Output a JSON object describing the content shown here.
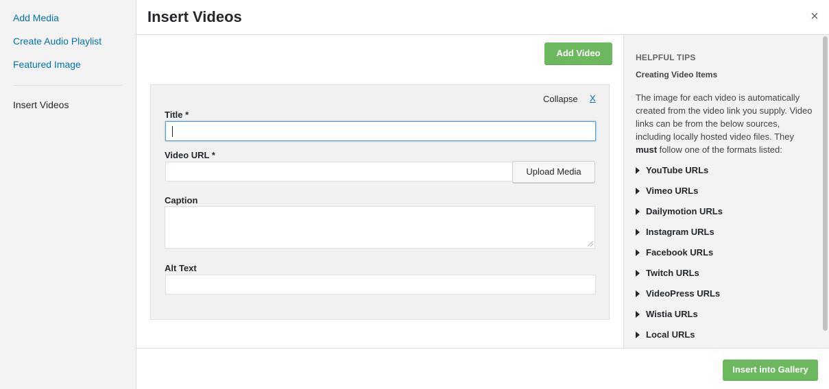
{
  "menu": {
    "items": [
      {
        "label": "Add Media"
      },
      {
        "label": "Create Audio Playlist"
      },
      {
        "label": "Featured Image"
      }
    ],
    "active_label": "Insert Videos"
  },
  "frame": {
    "title": "Insert Videos",
    "close_symbol": "×"
  },
  "main": {
    "add_video_label": "Add Video",
    "collapse_label": "Collapse",
    "remove_label": "X",
    "fields": {
      "title_label": "Title *",
      "title_value": "",
      "video_url_label": "Video URL *",
      "video_url_value": "",
      "upload_label": "Upload Media",
      "caption_label": "Caption",
      "caption_value": "",
      "alt_text_label": "Alt Text",
      "alt_text_value": ""
    }
  },
  "tips": {
    "heading": "Helpful Tips",
    "subheading": "Creating Video Items",
    "body_before": "The image for each video is automatically created from the video link you supply. Video links can be from the below sources, including locally hosted video files. They ",
    "body_bold": "must",
    "body_after": " follow one of the formats listed:",
    "sources": [
      "YouTube URLs",
      "Vimeo URLs",
      "Dailymotion URLs",
      "Instagram URLs",
      "Facebook URLs",
      "Twitch URLs",
      "VideoPress URLs",
      "Wistia URLs",
      "Local URLs"
    ]
  },
  "toolbar": {
    "insert_label": "Insert into Gallery"
  },
  "colors": {
    "accent_green": "#6cb85f",
    "link_blue": "#0073aa",
    "focus_blue": "#5b9dd9"
  }
}
